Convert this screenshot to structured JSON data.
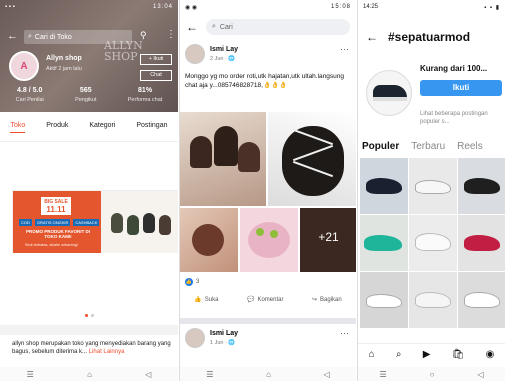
{
  "shop": {
    "status_time": "13:04",
    "search_placeholder": "Cari di Toko",
    "shop_name": "Allyn shop",
    "shop_sub": "Aktif 2 jam lalu",
    "follow_label": "+ Ikuti",
    "chat_label": "Chat",
    "watermark": "ALLYN SHOP",
    "stats": [
      {
        "value": "4.8 / 5.0",
        "label": "Cari Penilai"
      },
      {
        "value": "565",
        "label": "Pengikut"
      },
      {
        "value": "81%",
        "label": "Performa chat"
      }
    ],
    "tabs": [
      "Toko",
      "Produk",
      "Kategori",
      "Postingan"
    ],
    "active_tab": "Toko",
    "banner": {
      "sale_top": "BIG SALE",
      "sale_big": "11.11",
      "pills": [
        "COD",
        "GRATIS ONGKIR",
        "CASHBACK"
      ],
      "promo": "PROMO PRODUK FAVORIT DI TOKO KAMI!",
      "promo_sub": "Stok terbatas, sikatin sekarang!"
    },
    "description": "allyn shop merupakan toko yang menyediakan barang yang bagus, sebelum diterima k...",
    "more_link": "Lihat Lainnya"
  },
  "facebook": {
    "status_time": "15:08",
    "search_placeholder": "Cari",
    "post": {
      "author": "Ismi Lay",
      "date": "2 Jun · ",
      "text": "Monggo yg mo order roti,utk hajatan,utk ultah.langsung chat aja y...085746828718,👌👌👌",
      "more_count": "+21",
      "reactions": "3",
      "actions": [
        "Suka",
        "Komentar",
        "Bagikan"
      ]
    },
    "post2": {
      "author": "Ismi Lay",
      "date": "1 Jun · "
    }
  },
  "instagram": {
    "status_time": "14:25",
    "hashtag": "#sepatuarmod",
    "posts_caption": "Kurang dari 100...",
    "follow_label": "Ikuti",
    "hint": "Lihat beberapa postingan populer s...",
    "tabs": [
      "Populer",
      "Terbaru",
      "Reels"
    ],
    "active_tab": "Populer"
  },
  "colors": {
    "shopee_accent": "#ee4d2d",
    "facebook_blue": "#1877f2",
    "instagram_blue": "#3797f0"
  }
}
